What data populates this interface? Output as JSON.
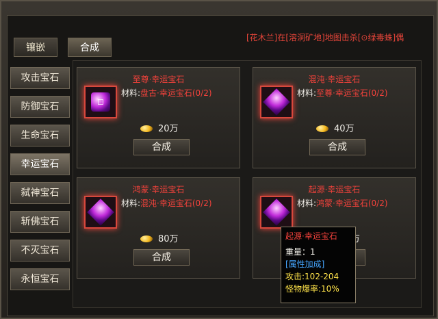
{
  "tabs": [
    {
      "label": "镶嵌"
    },
    {
      "label": "合成"
    }
  ],
  "notice": "[花木兰]在[溶洞矿地]地图击杀[⊙绿毒蛛]偶",
  "sidebar": [
    {
      "label": "攻击宝石"
    },
    {
      "label": "防御宝石"
    },
    {
      "label": "生命宝石"
    },
    {
      "label": "幸运宝石"
    },
    {
      "label": "弑神宝石"
    },
    {
      "label": "斩佛宝石"
    },
    {
      "label": "不灭宝石"
    },
    {
      "label": "永恒宝石"
    }
  ],
  "cards": [
    {
      "title": "至尊·幸运宝石",
      "material_label": "材料:",
      "material": "盘古·幸运宝石(0/2)",
      "price": "20万",
      "button": "合成"
    },
    {
      "title": "混沌·幸运宝石",
      "material_label": "材料:",
      "material": "至尊·幸运宝石(0/2)",
      "price": "40万",
      "button": "合成"
    },
    {
      "title": "鸿蒙·幸运宝石",
      "material_label": "材料:",
      "material": "混沌·幸运宝石(0/2)",
      "price": "80万",
      "button": "合成"
    },
    {
      "title": "起源·幸运宝石",
      "material_label": "材料:",
      "material": "鸿蒙·幸运宝石(0/2)",
      "price": "160万",
      "button": "合成"
    }
  ],
  "tooltip": {
    "title": "起源·幸运宝石",
    "weight": "重量：1",
    "attr_header": "[属性加成]",
    "attack": "攻击:102-204",
    "drop_rate": "怪物爆率:10%"
  }
}
